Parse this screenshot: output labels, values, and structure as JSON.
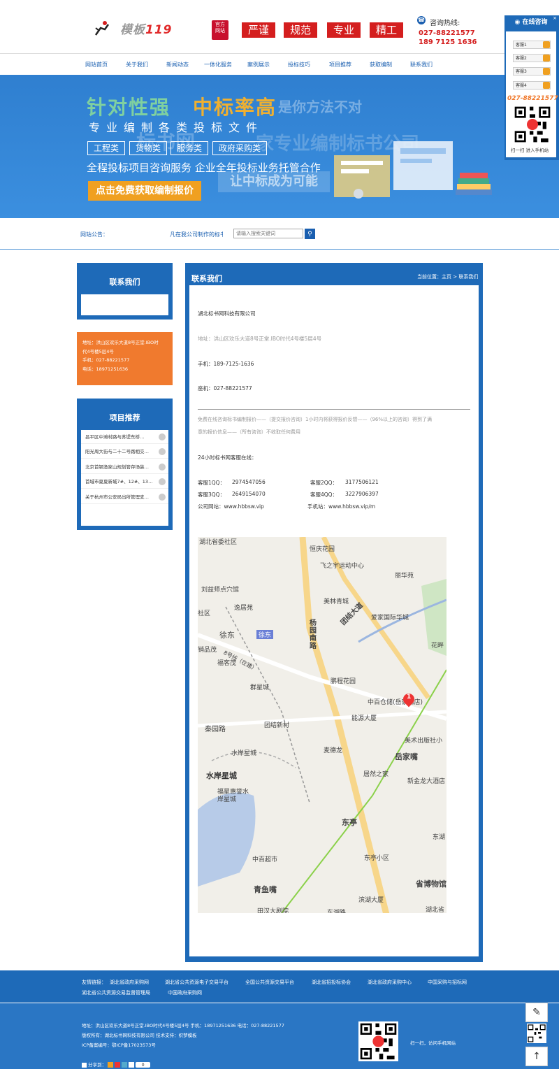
{
  "header": {
    "logo_text": "模板",
    "logo_num": "119",
    "seal_text": [
      "官方",
      "网站"
    ],
    "tags": [
      "严谨",
      "规范",
      "专业",
      "精工"
    ],
    "hotline_label": "咨询热线:",
    "hotline_numbers": [
      "027-88221577",
      "189 7125 1636"
    ]
  },
  "nav": {
    "items": [
      "网站首页",
      "关于我们",
      "新闻动态",
      "一体化服务",
      "案例展示",
      "投标技巧",
      "项目推荐",
      "获取编制",
      "联系我们"
    ]
  },
  "banner": {
    "headline_a": "针对性强",
    "headline_b": "中标率高",
    "ghost": "是你方法不对",
    "subtitle": "专业编制各类投标文件",
    "pills": [
      "工程类",
      "货物类",
      "服务类",
      "政府采购类"
    ],
    "watermark_a": "标书网",
    "watermark_b": "一家专业编制标书公司",
    "line": "全程投标项目咨询服务 企业全年投标业务托管合作",
    "cta": "点击免费获取编制报价",
    "slogan": "让中标成为可能"
  },
  "notice": {
    "label": "网站公告：",
    "text": "凡在我公司制作的标书",
    "search_placeholder": "请输入搜索关键词"
  },
  "sidebar": {
    "contact_title": "联系我们",
    "contact_lines": [
      "地址：洪山区欢乐大道8号正堂.IBO时",
      "代4号楼5层4号",
      "手机：027-88221577",
      "电话：18971251636"
    ],
    "rec_title": "项目推荐",
    "rec_items": [
      "昌平区中滩村路与苏堤东桥…",
      "阳光周大街与二十二号路相交…",
      "北京首钢渔家山规划管存场装…",
      "首城市夏夏新城7#、12#、13…",
      "关于杭州市公安局出所管理支…"
    ]
  },
  "main": {
    "title": "联系我们",
    "breadcrumb": "当前位置：主页 > 联系我们",
    "company": "湖北标书网科技有限公司",
    "address": "地址：洪山区欢乐大道8号正堂.IBO时代4号楼5层4号",
    "mobile": "手机：189-7125-1636",
    "landline": "座机：027-88221577",
    "free_text_1": "免费在线咨询标书编制报价——（提交报价咨询）1小时内将获得报价反馈——（96%以上的咨询）得到了满",
    "free_text_2": "意的报价信息——（所有咨询）不收取任何费用",
    "service_heading": "24小时标书网客服在线：",
    "qq": [
      {
        "label": "客服1QQ：",
        "value": "2974547056"
      },
      {
        "label": "客服2QQ：",
        "value": "3177506121"
      },
      {
        "label": "客服3QQ：",
        "value": "2649154070"
      },
      {
        "label": "客服4QQ：",
        "value": "3227906397"
      }
    ],
    "website": "公司网站：www.hbbsw.vip",
    "mobile_site": "手机站：www.hbbsw.vip/m"
  },
  "map": {
    "labels": [
      "湖北省委社区",
      "恒庆花园",
      "飞之宇运动中心",
      "丽华苑",
      "刘益师点穴馆",
      "逸居苑",
      "美林青城",
      "社区",
      "爱家国际华城",
      "徐东",
      "花畔",
      "销品茂",
      "福客茂",
      "杨园南路",
      "团结大道",
      "群星城",
      "鹏程花园",
      "中百仓储(岳家嘴店)",
      "秦园路",
      "团结新村",
      "能源大厦",
      "美术出版社小",
      "水岸星城",
      "麦德龙",
      "岳家嘴",
      "居然之家",
      "新金龙大酒店",
      "福星惠誉水岸星城",
      "东亭",
      "东湖",
      "中百超市",
      "东亭小区",
      "省博物馆",
      "青鱼嘴",
      "滨湖大厦",
      "湖北省",
      "田汉大剧院",
      "东湖路",
      "8号线（在建）"
    ],
    "bold_labels": [
      "水岸星城"
    ],
    "metro": [
      "徐东"
    ],
    "marker": "1"
  },
  "links": {
    "label": "友情链接：",
    "items": [
      "湖北省政府采购网",
      "湖北省公共资源电子交易平台",
      "全国公共资源交易平台",
      "湖北省招投标协会",
      "湖北省政府采购中心",
      "中国采购与招标网",
      "湖北省公共资源交易监督管理局",
      "中国政府采购网"
    ]
  },
  "footer": {
    "line1": "地址：洪山区欢乐大道8号正堂.IBO时代4号楼5层4号 手机：18971251636 电话：027-88221577",
    "line2": "版权所有：湖北标书网科技有限公司 技术支持：织梦模板",
    "line3": "ICP备案编号：鄂ICP备17023573号",
    "share_label": "分享到：",
    "share_count": "0",
    "qr_text": "扫一扫，访问手机网站"
  },
  "float": {
    "title": "在线咨询",
    "kefu": [
      "客服1",
      "客服2",
      "客服3",
      "客服4"
    ],
    "phone": "027-88221577",
    "scan_text": "扫一扫 进入手机站"
  },
  "tools": {
    "edit_icon": "✎",
    "top_icon": "↑"
  }
}
